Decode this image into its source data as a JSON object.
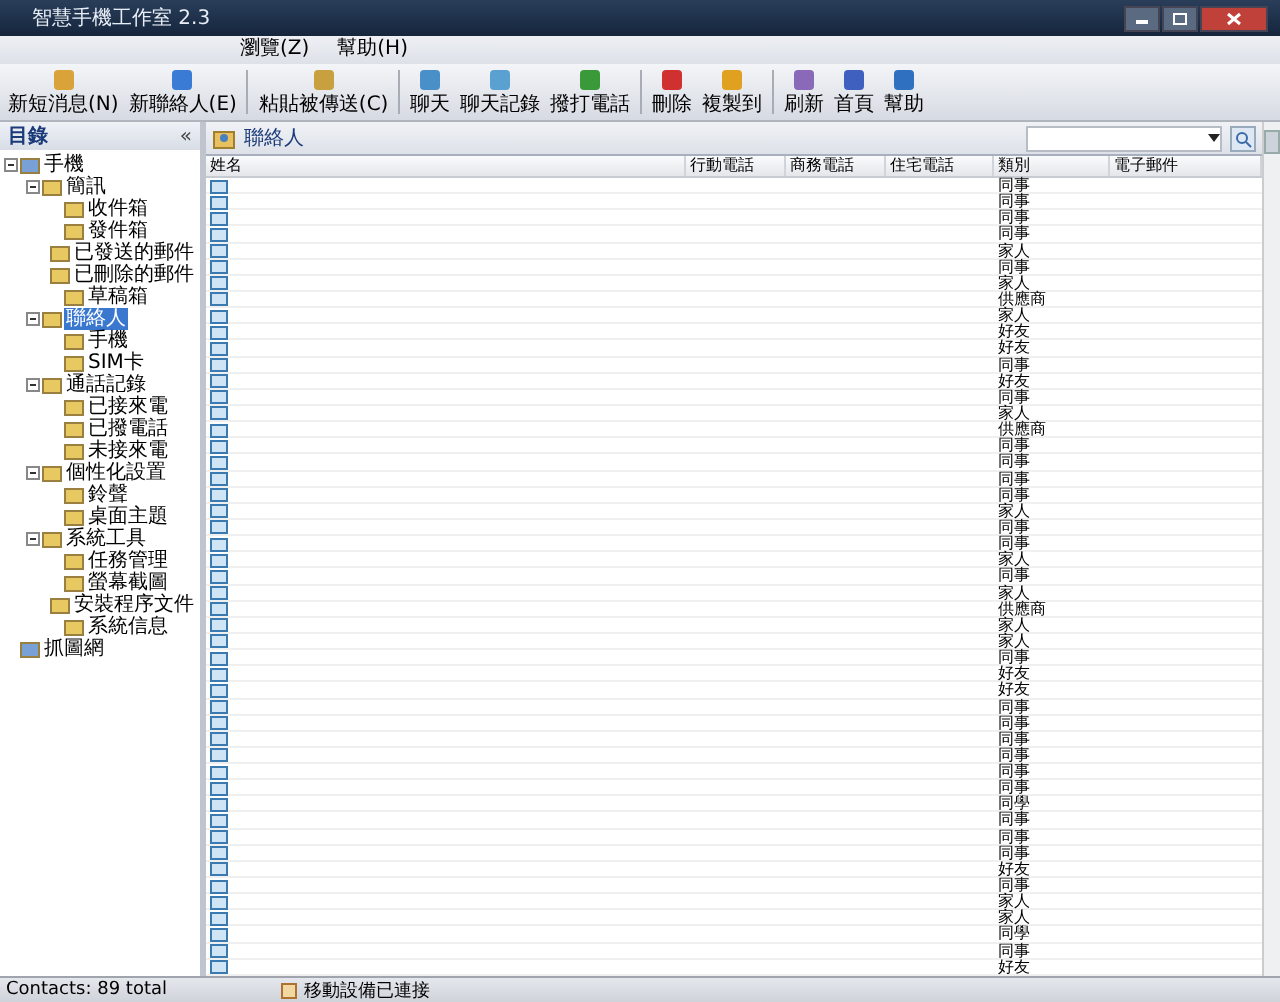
{
  "window": {
    "title": "智慧手機工作室 2.3"
  },
  "menu": [
    "瀏覽(Z)",
    "幫助(H)"
  ],
  "toolbar": [
    {
      "label": "新短消息(N)",
      "kind": "message"
    },
    {
      "label": "新聯絡人(E)",
      "kind": "contact"
    },
    {
      "label": "粘貼被傳送(C)",
      "kind": "paste"
    },
    {
      "label": "聊天",
      "kind": "chat"
    },
    {
      "label": "聊天記錄",
      "kind": "history"
    },
    {
      "label": "撥打電話",
      "kind": "phone"
    },
    {
      "label": "刪除",
      "kind": "delete"
    },
    {
      "label": "複製到",
      "kind": "copy"
    },
    {
      "label": "刷新",
      "kind": "refresh"
    },
    {
      "label": "首頁",
      "kind": "home"
    },
    {
      "label": "幫助",
      "kind": "help"
    }
  ],
  "sidebar": {
    "title": "目錄",
    "collapse": "«",
    "tree": [
      {
        "label": "手機",
        "selected": false,
        "expanded": true,
        "children": [
          {
            "label": "簡訊",
            "selected": false,
            "expanded": true,
            "children": [
              {
                "label": "收件箱",
                "selected": false
              },
              {
                "label": "發件箱",
                "selected": false
              },
              {
                "label": "已發送的郵件",
                "selected": false
              },
              {
                "label": "已刪除的郵件",
                "selected": false
              },
              {
                "label": "草稿箱",
                "selected": false
              }
            ]
          },
          {
            "label": "聯絡人",
            "selected": true,
            "expanded": true,
            "children": [
              {
                "label": "手機",
                "selected": false
              },
              {
                "label": "SIM卡",
                "selected": false
              }
            ]
          },
          {
            "label": "通話記錄",
            "selected": false,
            "expanded": true,
            "children": [
              {
                "label": "已接來電",
                "selected": false
              },
              {
                "label": "已撥電話",
                "selected": false
              },
              {
                "label": "未接來電",
                "selected": false
              }
            ]
          },
          {
            "label": "個性化設置",
            "selected": false,
            "expanded": true,
            "children": [
              {
                "label": "鈴聲",
                "selected": false
              },
              {
                "label": "桌面主題",
                "selected": false
              }
            ]
          },
          {
            "label": "系統工具",
            "selected": false,
            "expanded": true,
            "children": [
              {
                "label": "任務管理",
                "selected": false
              },
              {
                "label": "螢幕截圖",
                "selected": false
              },
              {
                "label": "安裝程序文件",
                "selected": false
              },
              {
                "label": "系統信息",
                "selected": false
              }
            ]
          }
        ]
      },
      {
        "label": "抓圖網",
        "selected": false
      }
    ]
  },
  "content": {
    "title": "聯絡人"
  },
  "table": {
    "columns": [
      "姓名",
      "行動電話",
      "商務電話",
      "住宅電話",
      "類別",
      "電子郵件"
    ],
    "rows": [
      "同事",
      "同事",
      "同事",
      "同事",
      "家人",
      "同事",
      "家人",
      "供應商",
      "家人",
      "好友",
      "好友",
      "同事",
      "好友",
      "同事",
      "家人",
      "供應商",
      "同事",
      "同事",
      "同事",
      "同事",
      "家人",
      "同事",
      "同事",
      "家人",
      "同事",
      "家人",
      "供應商",
      "家人",
      "家人",
      "同事",
      "好友",
      "好友",
      "同事",
      "同事",
      "同事",
      "同事",
      "同事",
      "同事",
      "同學",
      "同事",
      "同事",
      "同事",
      "好友",
      "同事",
      "家人",
      "家人",
      "同學",
      "同事",
      "好友"
    ]
  },
  "status_bar": {
    "count": "Contacts: 89 total",
    "device": "移動設備已連接"
  }
}
